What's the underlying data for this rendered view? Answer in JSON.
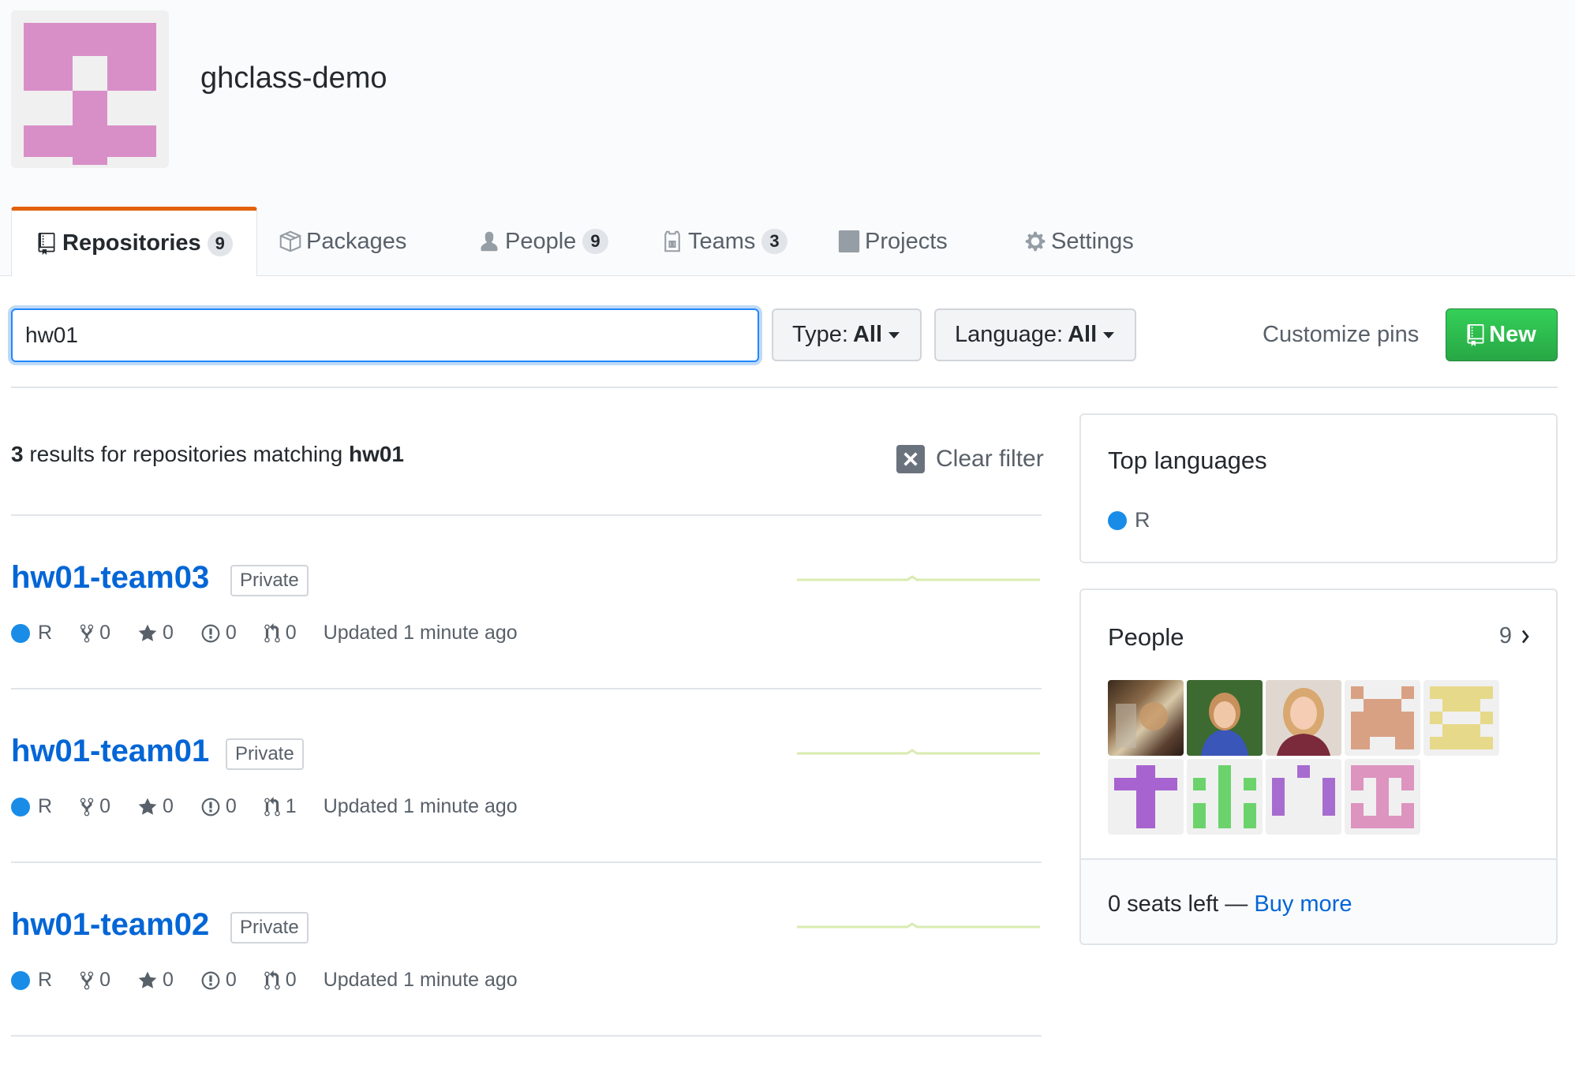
{
  "org": {
    "name": "ghclass-demo",
    "avatar_icon": "identicon-pink",
    "avatar_color": "#d88fc8"
  },
  "tabs": [
    {
      "label": "Repositories",
      "count": "9",
      "icon": "repo-icon"
    },
    {
      "label": "Packages",
      "icon": "package-icon"
    },
    {
      "label": "People",
      "count": "9",
      "icon": "person-icon"
    },
    {
      "label": "Teams",
      "count": "3",
      "icon": "jersey-icon"
    },
    {
      "label": "Projects",
      "icon": "project-icon"
    },
    {
      "label": "Settings",
      "icon": "gear-icon"
    }
  ],
  "filters": {
    "search_value": "hw01",
    "type_label": "Type:",
    "type_value": "All",
    "language_label": "Language:",
    "language_value": "All",
    "customize_pins": "Customize pins",
    "new_label": "New"
  },
  "results": {
    "count": "3",
    "text": "results for repositories matching",
    "query": "hw01",
    "clear_filter": "Clear filter"
  },
  "repos": [
    {
      "name": "hw01-team03",
      "visibility": "Private",
      "language": "R",
      "forks": "0",
      "stars": "0",
      "issues": "0",
      "pulls": "0",
      "updated": "Updated 1 minute ago"
    },
    {
      "name": "hw01-team01",
      "visibility": "Private",
      "language": "R",
      "forks": "0",
      "stars": "0",
      "issues": "0",
      "pulls": "1",
      "updated": "Updated 1 minute ago"
    },
    {
      "name": "hw01-team02",
      "visibility": "Private",
      "language": "R",
      "forks": "0",
      "stars": "0",
      "issues": "0",
      "pulls": "0",
      "updated": "Updated 1 minute ago"
    }
  ],
  "sidebar": {
    "top_languages_title": "Top languages",
    "top_language": "R",
    "language_color": "#198ce7",
    "people_title": "People",
    "people_count": "9",
    "seats_text": "0 seats left —",
    "buy_more": "Buy more"
  },
  "colors": {
    "link": "#0366d6",
    "tab_accent": "#e36209",
    "new_button": "#28a745",
    "sparkline": "#d9ebb0"
  }
}
